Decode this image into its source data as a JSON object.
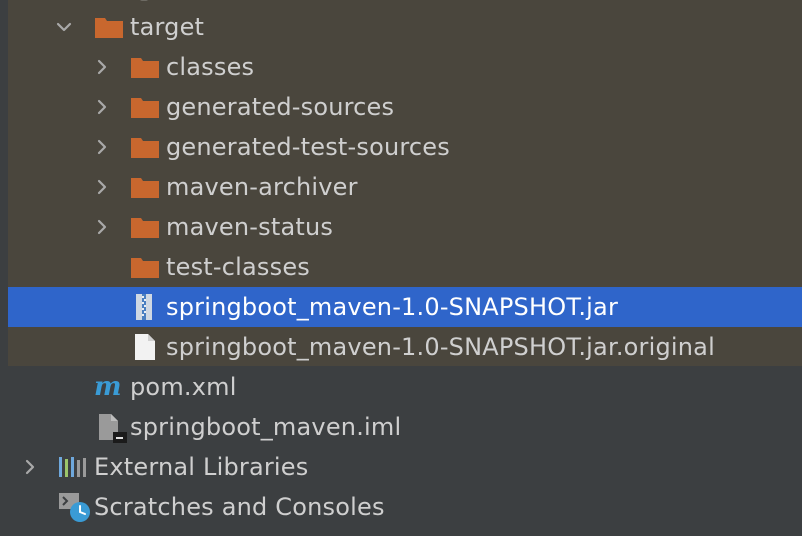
{
  "project_tree": {
    "items": [
      {
        "label": "target",
        "kind": "folder",
        "expanded": true,
        "icon": "folder-icon"
      },
      {
        "label": "classes",
        "kind": "folder",
        "expanded": false,
        "icon": "folder-icon"
      },
      {
        "label": "generated-sources",
        "kind": "folder",
        "expanded": false,
        "icon": "folder-icon"
      },
      {
        "label": "generated-test-sources",
        "kind": "folder",
        "expanded": false,
        "icon": "folder-icon"
      },
      {
        "label": "maven-archiver",
        "kind": "folder",
        "expanded": false,
        "icon": "folder-icon"
      },
      {
        "label": "maven-status",
        "kind": "folder",
        "expanded": false,
        "icon": "folder-icon"
      },
      {
        "label": "test-classes",
        "kind": "folder",
        "icon": "folder-icon"
      },
      {
        "label": "springboot_maven-1.0-SNAPSHOT.jar",
        "kind": "file",
        "selected": true,
        "icon": "jar-file-icon"
      },
      {
        "label": "springboot_maven-1.0-SNAPSHOT.jar.original",
        "kind": "file",
        "icon": "text-file-icon"
      },
      {
        "label": "pom.xml",
        "kind": "file",
        "icon": "maven-m-icon"
      },
      {
        "label": "springboot_maven.iml",
        "kind": "file",
        "icon": "iml-file-icon"
      },
      {
        "label": "External Libraries",
        "kind": "node",
        "expanded": false,
        "icon": "libraries-icon"
      },
      {
        "label": "Scratches and Consoles",
        "kind": "node",
        "icon": "scratches-icon"
      }
    ]
  },
  "colors": {
    "panel_background": "#3c3f41",
    "excluded_folder_background": "#4a463d",
    "selection": "#2f65ca",
    "folder_orange": "#c8672e",
    "text": "#cfcfcf",
    "selected_text": "#ffffff",
    "maven_blue": "#3a9bd5"
  }
}
